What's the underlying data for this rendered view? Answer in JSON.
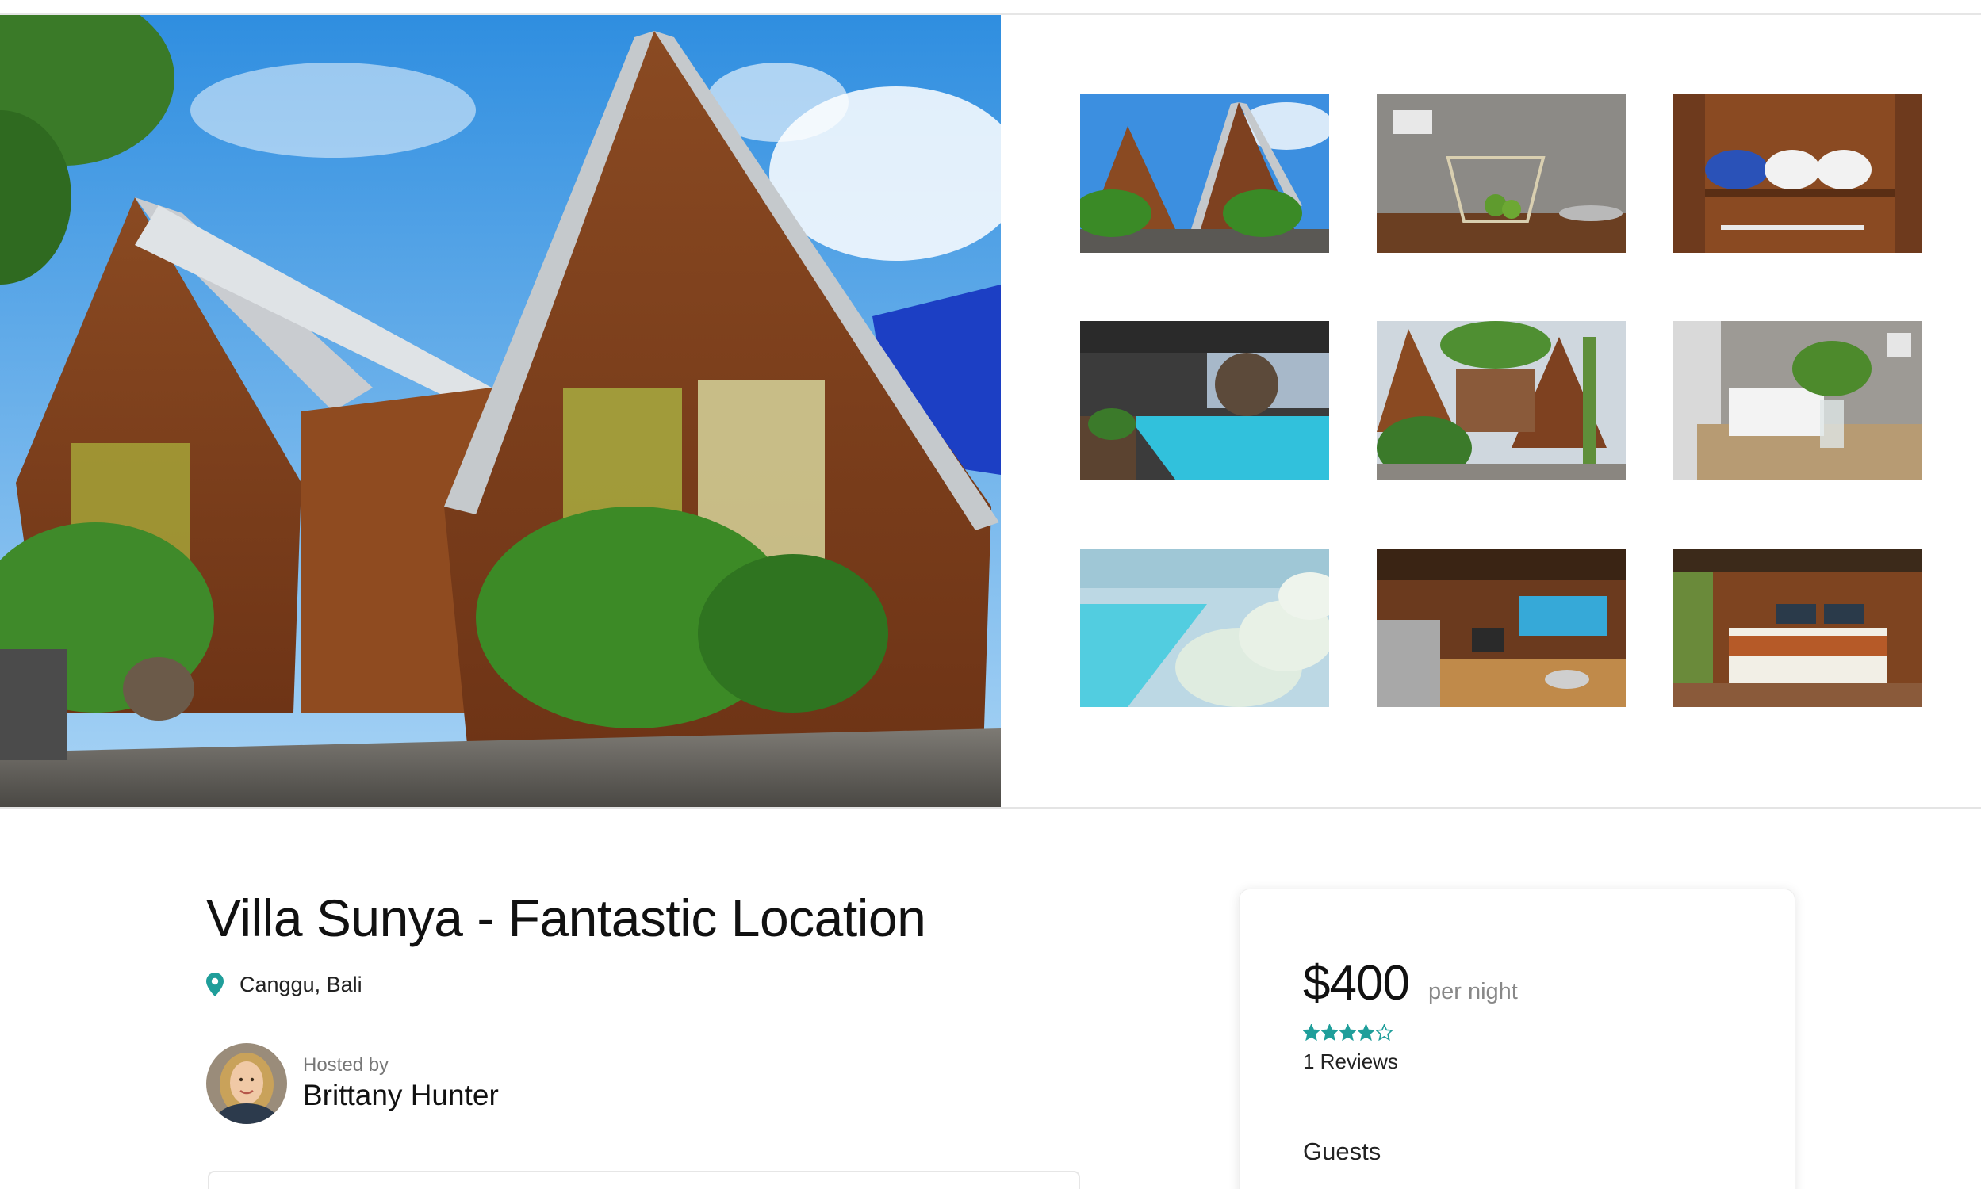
{
  "listing": {
    "title": "Villa Sunya - Fantastic Location",
    "location": "Canggu, Bali",
    "hosted_by_label": "Hosted by",
    "host_name": "Brittany Hunter"
  },
  "booking": {
    "price": "$400",
    "price_unit": "per night",
    "rating": 4,
    "rating_max": 5,
    "reviews": "1 Reviews",
    "guests_label": "Guests"
  },
  "colors": {
    "accent": "#1f9e9a",
    "text": "#111111",
    "muted": "#888888"
  },
  "icons": {
    "location": "map-pin-icon",
    "star_filled": "star-filled-icon",
    "star_empty": "star-outline-icon"
  }
}
